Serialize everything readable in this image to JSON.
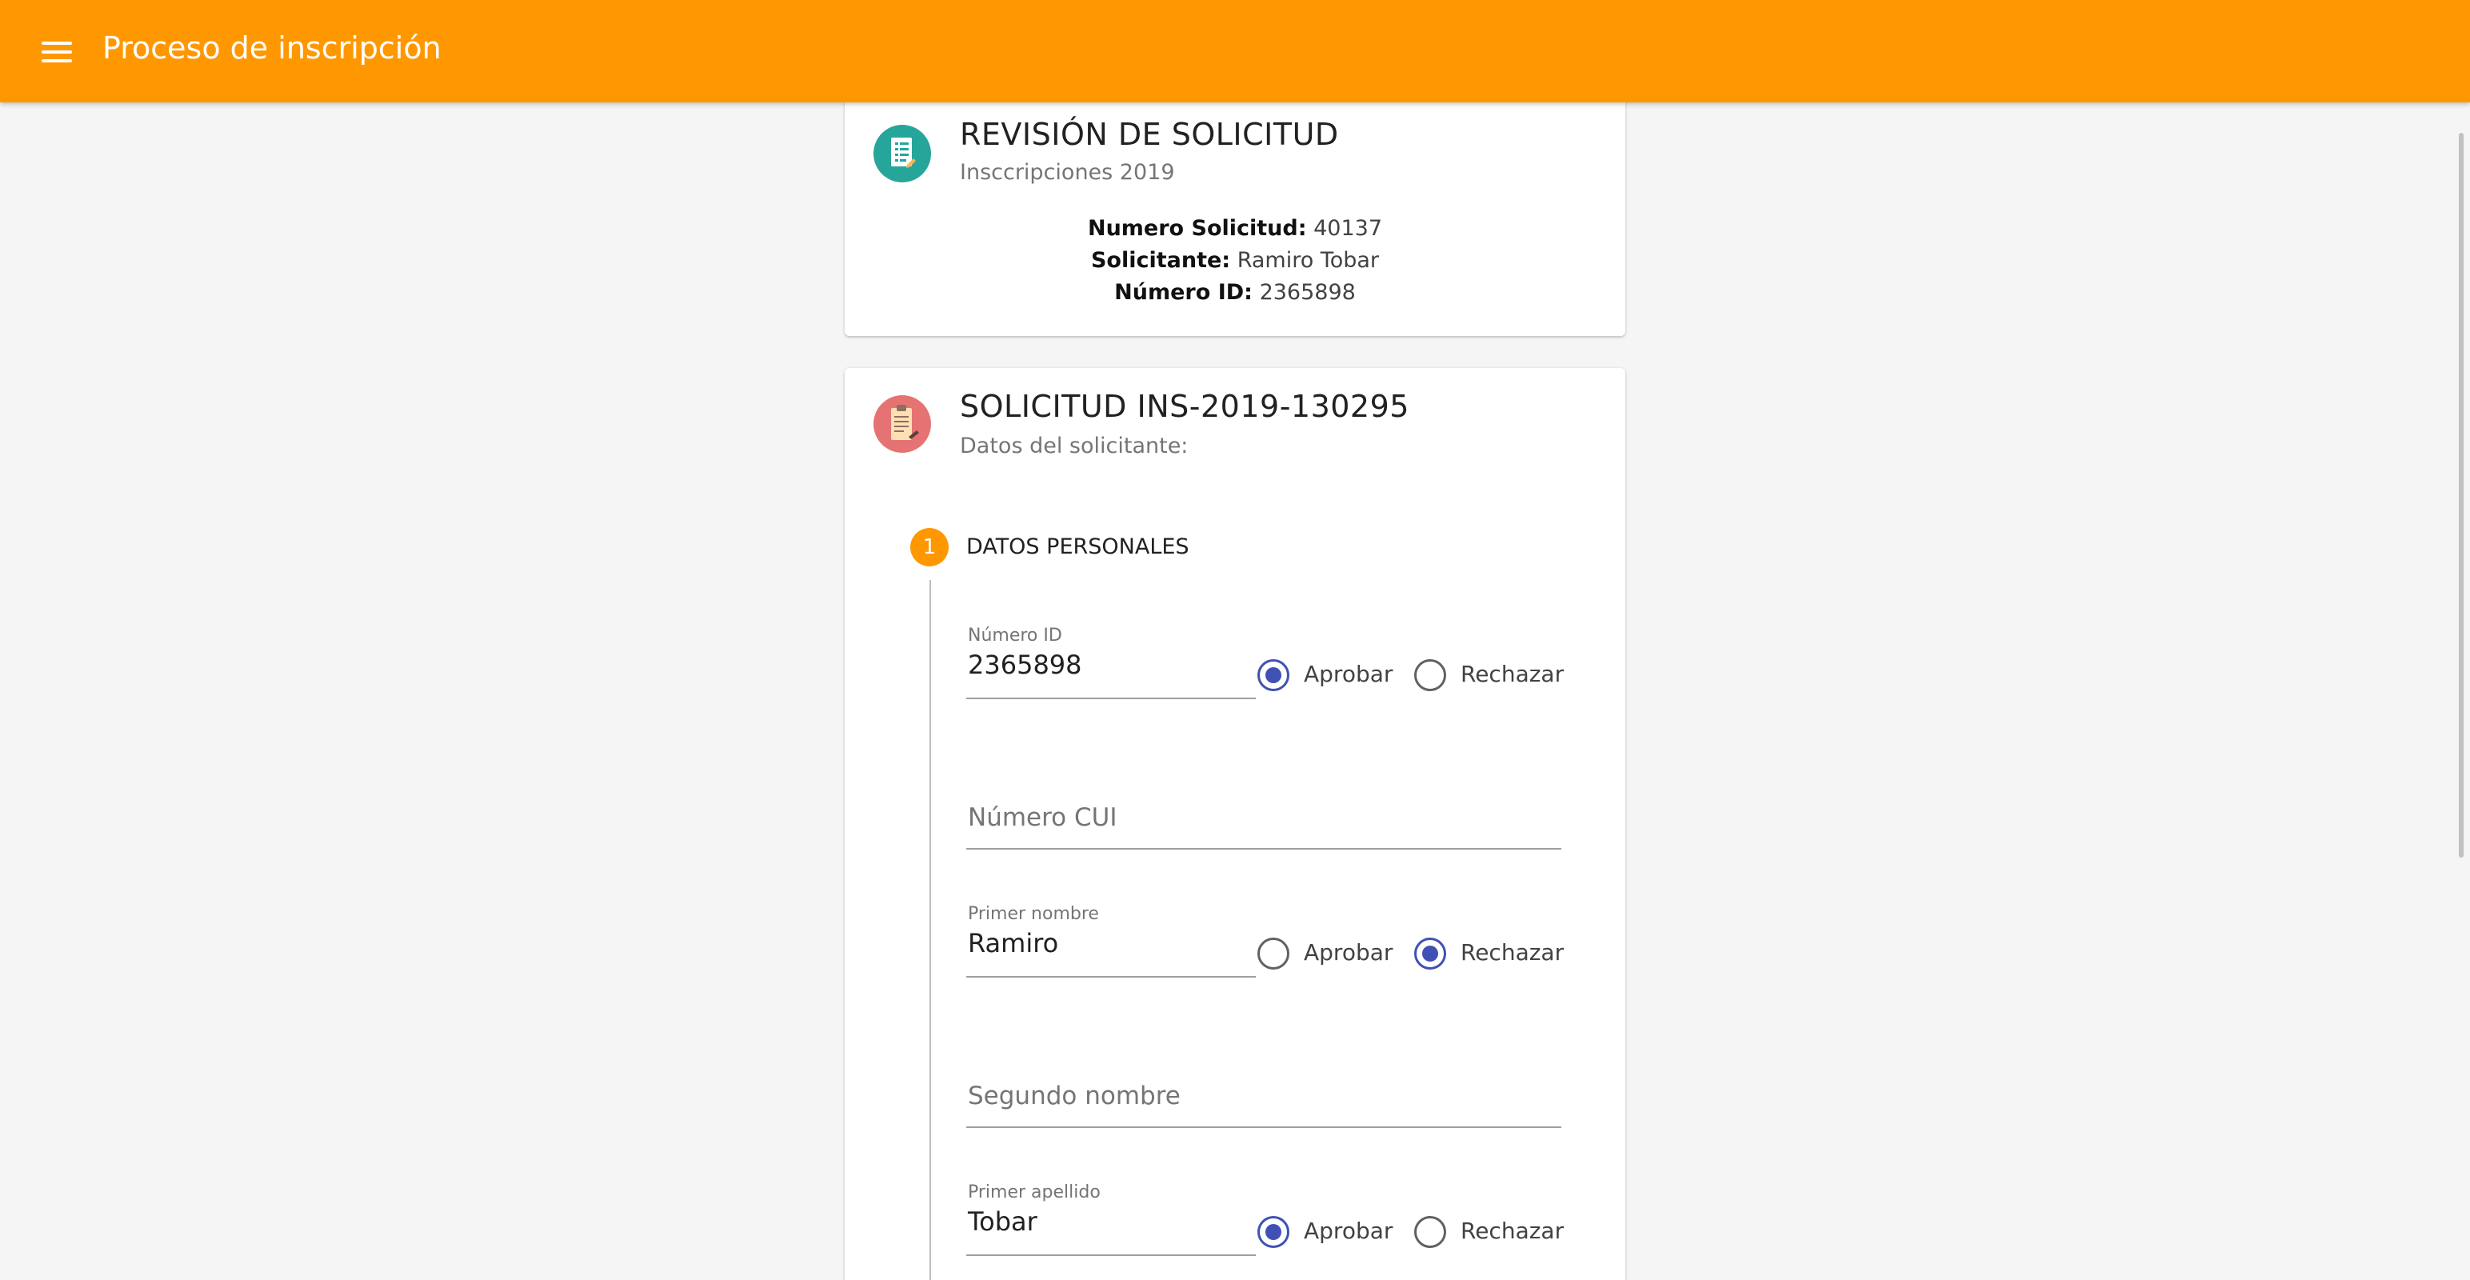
{
  "toolbar": {
    "menu_icon": "menu-icon",
    "title": "Proceso de inscripción",
    "color": "#ff9800"
  },
  "review_card": {
    "icon": "document-checklist-icon",
    "title": "REVISIÓN DE SOLICITUD",
    "subtitle": "Insccripciones 2019",
    "request_number_label": "Numero Solicitud:",
    "request_number_value": "40137",
    "applicant_label": "Solicitante:",
    "applicant_value": "Ramiro Tobar",
    "id_label": "Número ID:",
    "id_value": "2365898"
  },
  "request_card": {
    "icon": "clipboard-icon",
    "title": "SOLICITUD INS-2019-130295",
    "subtitle": "Datos del solicitante:",
    "step": {
      "number": "1",
      "label": "DATOS PERSONALES"
    },
    "fields": [
      {
        "label": "Número ID",
        "value": "2365898",
        "approve_label": "Aprobar",
        "reject_label": "Rechazar",
        "decision": "approve"
      },
      {
        "placeholder": "Número CUI"
      },
      {
        "label": "Primer nombre",
        "value": "Ramiro",
        "approve_label": "Aprobar",
        "reject_label": "Rechazar",
        "decision": "reject"
      },
      {
        "placeholder": "Segundo nombre"
      },
      {
        "label": "Primer apellido",
        "value": "Tobar",
        "approve_label": "Aprobar",
        "reject_label": "Rechazar",
        "decision": "approve"
      }
    ]
  },
  "colors": {
    "accent": "#ff9800",
    "radio_selected": "#3f51b5",
    "review_avatar": "#26a69a",
    "request_avatar": "#e57373"
  }
}
